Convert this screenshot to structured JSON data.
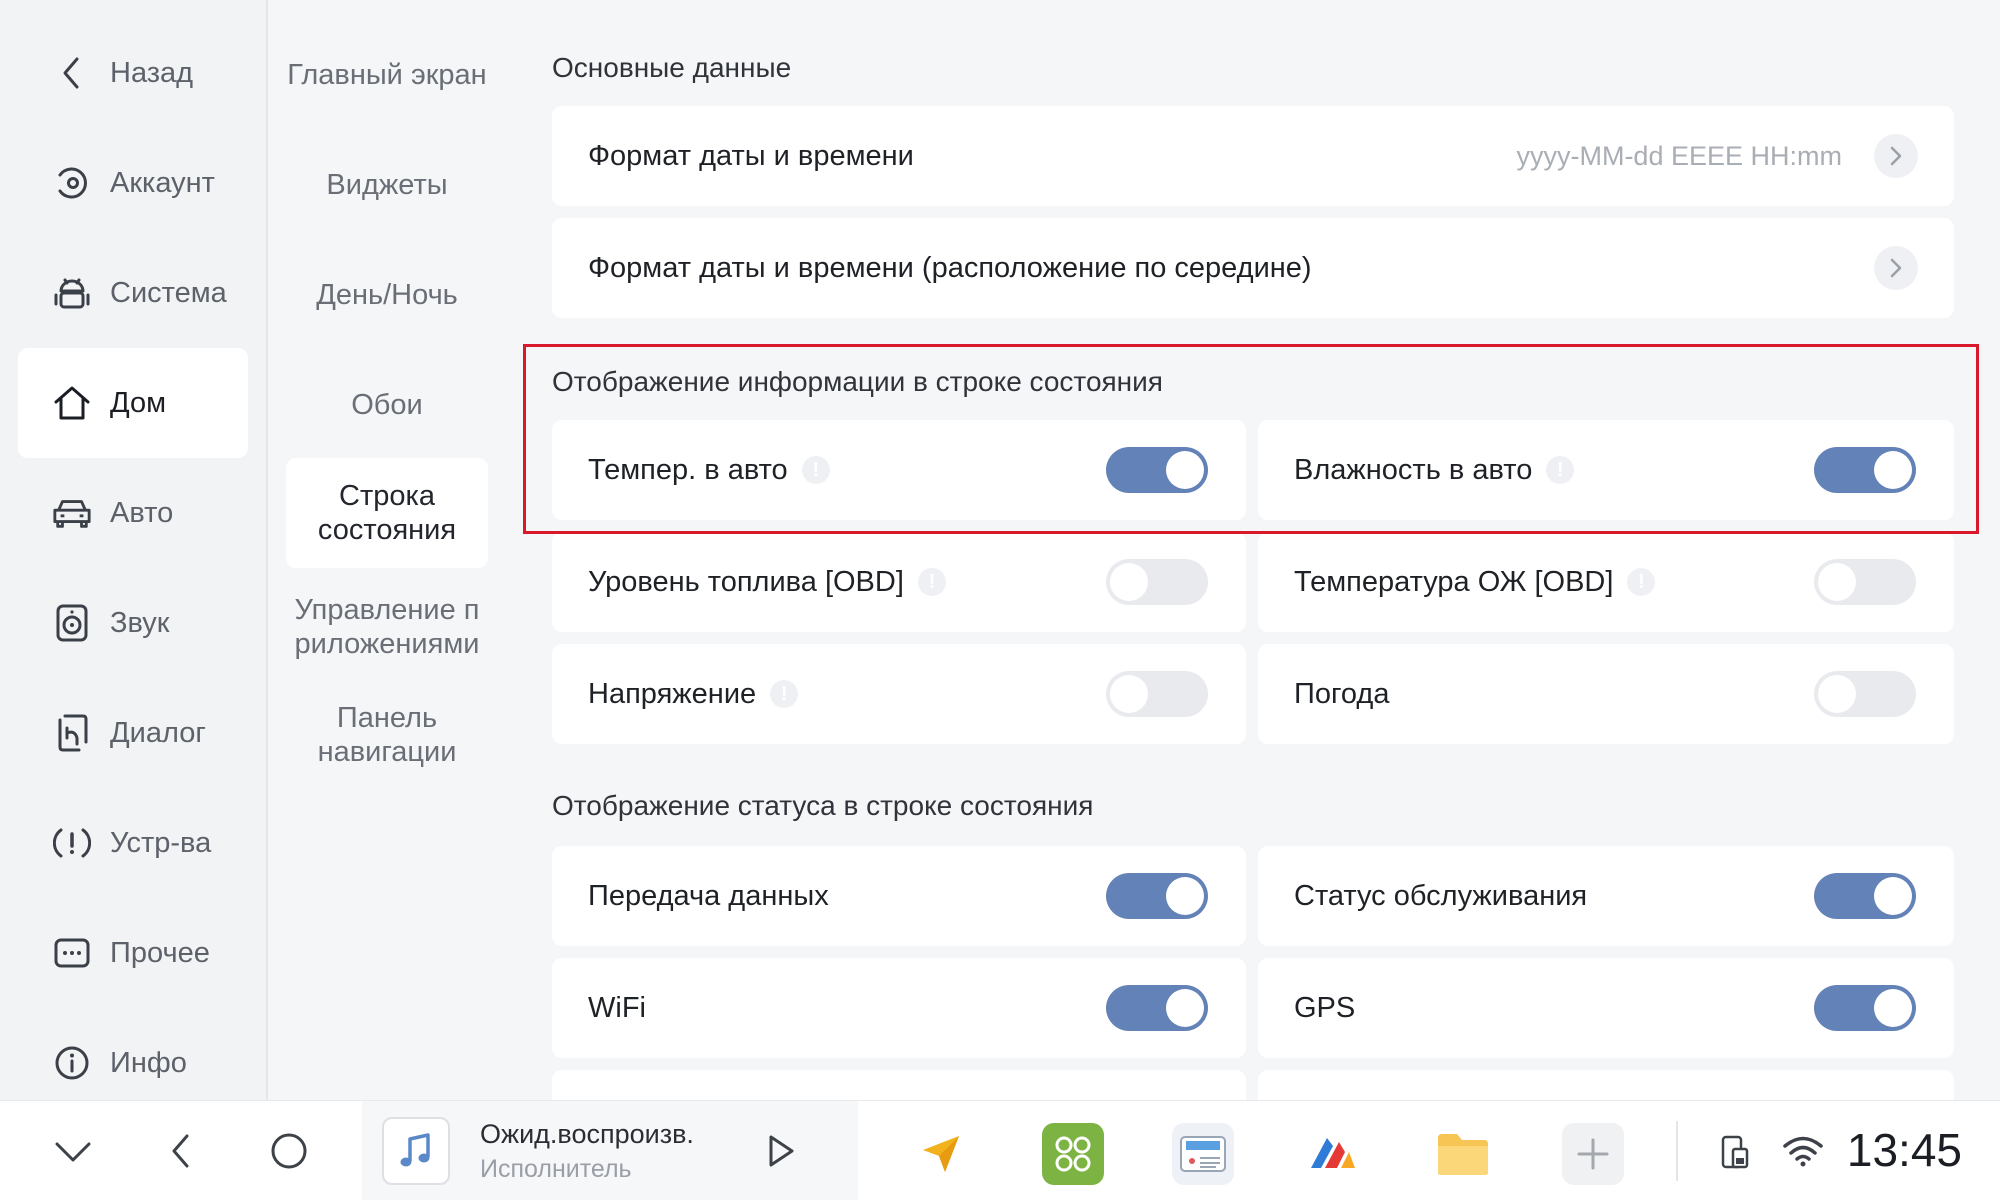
{
  "nav": {
    "items": [
      {
        "label": "Назад",
        "icon": "back-chevron-icon"
      },
      {
        "label": "Аккаунт",
        "icon": "account-icon"
      },
      {
        "label": "Система",
        "icon": "android-icon"
      },
      {
        "label": "Дом",
        "icon": "home-icon",
        "active": true
      },
      {
        "label": "Авто",
        "icon": "car-icon"
      },
      {
        "label": "Звук",
        "icon": "speaker-icon"
      },
      {
        "label": "Диалог",
        "icon": "voice-dialog-icon"
      },
      {
        "label": "Устр-ва",
        "icon": "devices-alert-icon"
      },
      {
        "label": "Прочее",
        "icon": "more-dots-icon"
      },
      {
        "label": "Инфо",
        "icon": "info-icon"
      }
    ]
  },
  "subnav": {
    "items": [
      {
        "label": "Главный экран"
      },
      {
        "label": "Виджеты"
      },
      {
        "label": "День/Ночь"
      },
      {
        "label": "Обои"
      },
      {
        "label": "Строка состояния",
        "active": true
      },
      {
        "label": "Управление приложениями"
      },
      {
        "label": "Панель навигации"
      }
    ]
  },
  "sections": {
    "basic": {
      "title": "Основные данные",
      "rows": [
        {
          "label": "Формат даты и времени",
          "value": "yyyy-MM-dd EEEE HH:mm"
        },
        {
          "label": "Формат даты и времени (расположение по середине)",
          "value": ""
        }
      ]
    },
    "info": {
      "title": "Отображение информации в строке состояния",
      "rows": [
        {
          "label": "Темпер. в авто",
          "info": true,
          "on": true
        },
        {
          "label": "Влажность в авто",
          "info": true,
          "on": true
        },
        {
          "label": "Уровень топлива [OBD]",
          "info": true,
          "on": false
        },
        {
          "label": "Температура ОЖ [OBD]",
          "info": true,
          "on": false
        },
        {
          "label": "Напряжение",
          "info": true,
          "on": false
        },
        {
          "label": "Погода",
          "info": false,
          "on": false
        }
      ]
    },
    "status": {
      "title": "Отображение статуса в строке состояния",
      "rows": [
        {
          "label": "Передача данных",
          "on": true
        },
        {
          "label": "Статус обслуживания",
          "on": true
        },
        {
          "label": "WiFi",
          "on": true
        },
        {
          "label": "GPS",
          "on": true
        }
      ]
    }
  },
  "dock": {
    "track_title": "Ожид.воспроизв.",
    "track_artist": "Исполнитель",
    "clock": "13:45",
    "apps": [
      "navigator-app-icon",
      "launcher-app-icon",
      "radio-app-icon",
      "media-app-icon",
      "files-app-icon",
      "add-app-icon"
    ]
  },
  "colors": {
    "toggle_on": "#6382b8",
    "toggle_off": "#e8eaed",
    "highlight": "#d9182a"
  }
}
